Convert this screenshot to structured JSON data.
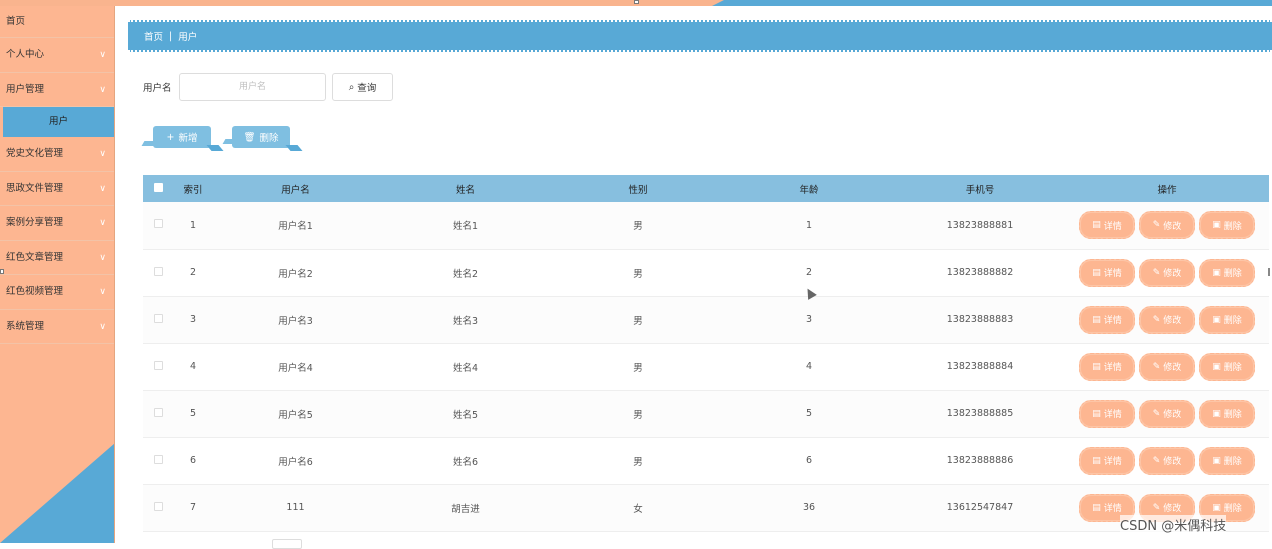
{
  "sidebar": {
    "items": [
      {
        "label": "首页",
        "has_chevron": false
      },
      {
        "label": "个人中心",
        "has_chevron": true
      },
      {
        "label": "用户管理",
        "has_chevron": true
      },
      {
        "label": "用户",
        "sub": true
      },
      {
        "label": "党史文化管理",
        "has_chevron": true
      },
      {
        "label": "思政文件管理",
        "has_chevron": true
      },
      {
        "label": "案例分享管理",
        "has_chevron": true
      },
      {
        "label": "红色文章管理",
        "has_chevron": true
      },
      {
        "label": "红色视频管理",
        "has_chevron": true
      },
      {
        "label": "系统管理",
        "has_chevron": true
      }
    ]
  },
  "breadcrumb": {
    "home": "首页",
    "separator": "|",
    "current": "用户"
  },
  "search": {
    "label": "用户名",
    "placeholder": "用户名",
    "button_label": "查询"
  },
  "toolbar": {
    "add_label": "新增",
    "delete_label": "删除"
  },
  "table": {
    "headers": [
      "索引",
      "用户名",
      "姓名",
      "性别",
      "年龄",
      "手机号",
      "操作"
    ],
    "rows": [
      {
        "index": "1",
        "username": "用户名1",
        "name": "姓名1",
        "gender": "男",
        "age": "1",
        "phone": "13823888881"
      },
      {
        "index": "2",
        "username": "用户名2",
        "name": "姓名2",
        "gender": "男",
        "age": "2",
        "phone": "13823888882"
      },
      {
        "index": "3",
        "username": "用户名3",
        "name": "姓名3",
        "gender": "男",
        "age": "3",
        "phone": "13823888883"
      },
      {
        "index": "4",
        "username": "用户名4",
        "name": "姓名4",
        "gender": "男",
        "age": "4",
        "phone": "13823888884"
      },
      {
        "index": "5",
        "username": "用户名5",
        "name": "姓名5",
        "gender": "男",
        "age": "5",
        "phone": "13823888885"
      },
      {
        "index": "6",
        "username": "用户名6",
        "name": "姓名6",
        "gender": "男",
        "age": "6",
        "phone": "13823888886"
      },
      {
        "index": "7",
        "username": "111",
        "name": "胡吉进",
        "gender": "女",
        "age": "36",
        "phone": "13612547847"
      }
    ],
    "row_actions": {
      "detail": "详情",
      "edit": "修改",
      "delete": "删除"
    }
  },
  "watermark": "CSDN @米偶科技",
  "colors": {
    "sidebar": "#fdb691",
    "accent_blue": "#58a9d6",
    "header_blue": "#87bfdf",
    "op_button": "#fdb691"
  }
}
